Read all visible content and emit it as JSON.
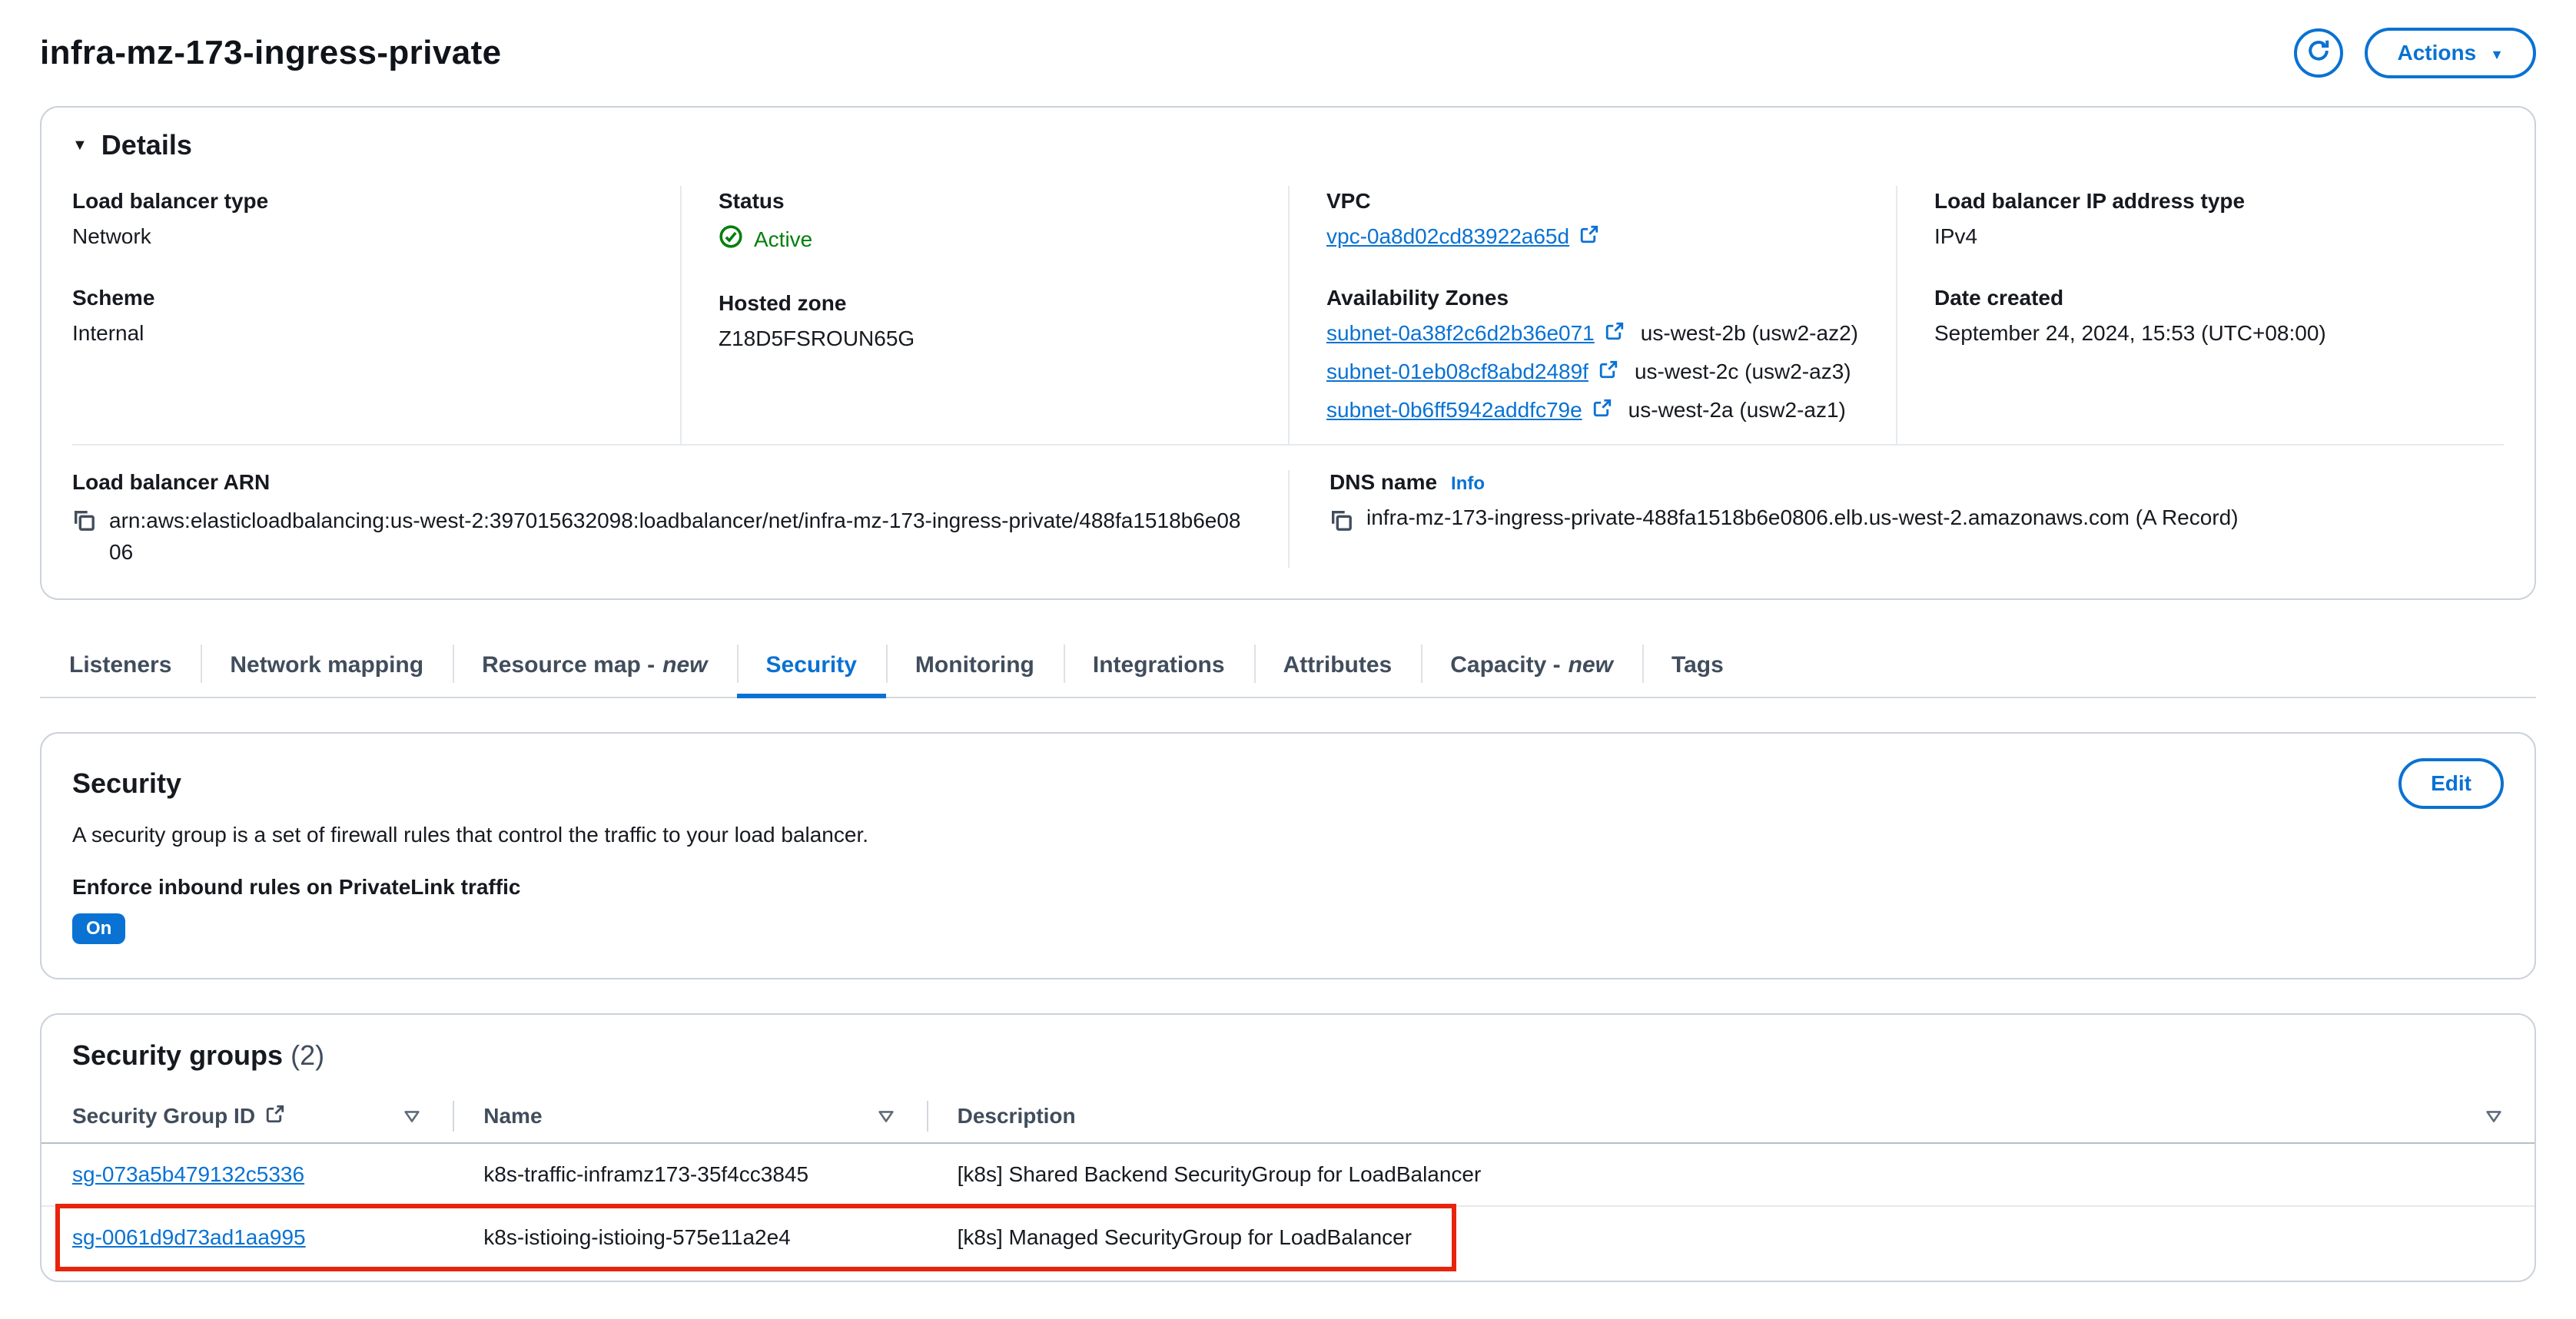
{
  "page": {
    "title": "infra-mz-173-ingress-private",
    "actions_button": "Actions"
  },
  "details": {
    "header": "Details",
    "lb_type_label": "Load balancer type",
    "lb_type_value": "Network",
    "scheme_label": "Scheme",
    "scheme_value": "Internal",
    "status_label": "Status",
    "status_value": "Active",
    "hosted_zone_label": "Hosted zone",
    "hosted_zone_value": "Z18D5FSROUN65G",
    "vpc_label": "VPC",
    "vpc_value": "vpc-0a8d02cd83922a65d",
    "az_label": "Availability Zones",
    "azs": [
      {
        "subnet": "subnet-0a38f2c6d2b36e071",
        "zone": "us-west-2b (usw2-az2)"
      },
      {
        "subnet": "subnet-01eb08cf8abd2489f",
        "zone": "us-west-2c (usw2-az3)"
      },
      {
        "subnet": "subnet-0b6ff5942addfc79e",
        "zone": "us-west-2a (usw2-az1)"
      }
    ],
    "ip_type_label": "Load balancer IP address type",
    "ip_type_value": "IPv4",
    "date_created_label": "Date created",
    "date_created_value": "September 24, 2024, 15:53 (UTC+08:00)",
    "arn_label": "Load balancer ARN",
    "arn_value": "arn:aws:elasticloadbalancing:us-west-2:397015632098:loadbalancer/net/infra-mz-173-ingress-private/488fa1518b6e0806",
    "dns_label": "DNS name",
    "dns_info": "Info",
    "dns_value": "infra-mz-173-ingress-private-488fa1518b6e0806.elb.us-west-2.amazonaws.com (A Record)"
  },
  "tabs": [
    {
      "label": "Listeners"
    },
    {
      "label": "Network mapping"
    },
    {
      "label": "Resource map -",
      "suffix": "new"
    },
    {
      "label": "Security",
      "active": true
    },
    {
      "label": "Monitoring"
    },
    {
      "label": "Integrations"
    },
    {
      "label": "Attributes"
    },
    {
      "label": "Capacity -",
      "suffix": "new"
    },
    {
      "label": "Tags"
    }
  ],
  "security": {
    "title": "Security",
    "edit_button": "Edit",
    "description": "A security group is a set of firewall rules that control the traffic to your load balancer.",
    "privatelink_label": "Enforce inbound rules on PrivateLink traffic",
    "privatelink_value": "On"
  },
  "security_groups": {
    "title": "Security groups",
    "count": "(2)",
    "columns": [
      {
        "label": "Security Group ID"
      },
      {
        "label": "Name"
      },
      {
        "label": "Description"
      }
    ],
    "rows": [
      {
        "id": "sg-073a5b479132c5336",
        "name": "k8s-traffic-inframz173-35f4cc3845",
        "description": "[k8s] Shared Backend SecurityGroup for LoadBalancer"
      },
      {
        "id": "sg-0061d9d73ad1aa995",
        "name": "k8s-istioing-istioing-575e11a2e4",
        "description": "[k8s] Managed SecurityGroup for LoadBalancer"
      }
    ],
    "highlighted_row_index": 1
  },
  "colors": {
    "accent": "#0972d3",
    "status_green": "#037f0c",
    "badge_bg": "#0972d3",
    "annotation_red": "#e8240c"
  },
  "icons": {
    "caret_down": "▼",
    "details_arrow": "▼",
    "refresh": "circular-arrow",
    "external_link": "box-with-arrow",
    "copy": "overlapping-squares",
    "check_circle": "check-in-circle",
    "sort": "outlined-down-triangle"
  }
}
